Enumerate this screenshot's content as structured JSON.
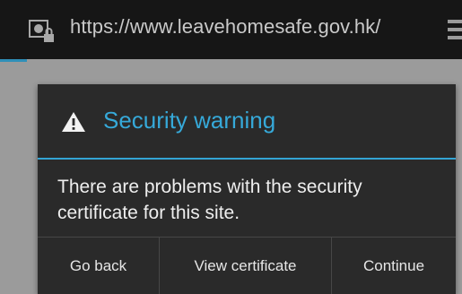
{
  "browser": {
    "url": "https://www.leavehomesafe.gov.hk/",
    "site_icon": "globe-lock-icon",
    "menu_icon": "overflow-menu-icon"
  },
  "dialog": {
    "title": "Security warning",
    "title_icon": "warning-triangle-icon",
    "message": "There are problems with the security certificate for this site.",
    "buttons": {
      "back": "Go back",
      "view_certificate": "View certificate",
      "continue": "Continue"
    }
  },
  "colors": {
    "accent": "#36a9d9",
    "dialog_bg": "#2a2a2a",
    "urlbar_bg": "#161616",
    "page_bg": "#9b9b9b"
  }
}
